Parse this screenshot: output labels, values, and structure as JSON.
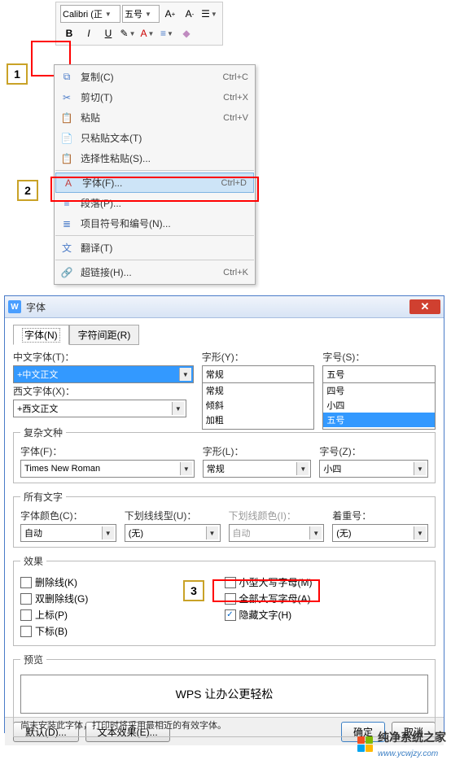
{
  "toolbar": {
    "font_family": "Calibri (正",
    "font_size": "五号",
    "bold": "B",
    "italic": "I",
    "underline": "U"
  },
  "context_menu": {
    "items": [
      {
        "icon": "copy",
        "label": "复制(C)",
        "shortcut": "Ctrl+C"
      },
      {
        "icon": "cut",
        "label": "剪切(T)",
        "shortcut": "Ctrl+X"
      },
      {
        "icon": "paste",
        "label": "粘贴",
        "shortcut": "Ctrl+V"
      },
      {
        "icon": "paste-text",
        "label": "只粘贴文本(T)",
        "shortcut": ""
      },
      {
        "icon": "paste-special",
        "label": "选择性粘贴(S)...",
        "shortcut": ""
      },
      {
        "icon": "font",
        "label": "字体(F)...",
        "shortcut": "Ctrl+D"
      },
      {
        "icon": "paragraph",
        "label": "段落(P)...",
        "shortcut": ""
      },
      {
        "icon": "bullets",
        "label": "项目符号和编号(N)...",
        "shortcut": ""
      },
      {
        "icon": "translate",
        "label": "翻译(T)",
        "shortcut": ""
      },
      {
        "icon": "link",
        "label": "超链接(H)...",
        "shortcut": "Ctrl+K"
      }
    ]
  },
  "dialog": {
    "title": "字体",
    "tabs": [
      "字体(N)",
      "字符间距(R)"
    ],
    "cn_font_label": "中文字体(T)：",
    "cn_font_value": "+中文正文",
    "style_label": "字形(Y)：",
    "style_value": "常规",
    "style_options": [
      "常规",
      "倾斜",
      "加粗"
    ],
    "size_label": "字号(S)：",
    "size_value": "五号",
    "size_options": [
      "四号",
      "小四",
      "五号"
    ],
    "en_font_label": "西文字体(X)：",
    "en_font_value": "+西文正文",
    "complex_legend": "复杂文种",
    "cx_font_label": "字体(F)：",
    "cx_font_value": "Times New Roman",
    "cx_style_label": "字形(L)：",
    "cx_style_value": "常规",
    "cx_size_label": "字号(Z)：",
    "cx_size_value": "小四",
    "all_text_legend": "所有文字",
    "color_label": "字体颜色(C)：",
    "color_value": "自动",
    "uline_label": "下划线线型(U)：",
    "uline_value": "(无)",
    "ucolor_label": "下划线颜色(I)：",
    "ucolor_value": "自动",
    "emph_label": "着重号：",
    "emph_value": "(无)",
    "effects_legend": "效果",
    "effects_left": [
      "删除线(K)",
      "双删除线(G)",
      "上标(P)",
      "下标(B)"
    ],
    "effects_right": [
      "小型大写字母(M)",
      "全部大写字母(A)",
      "隐藏文字(H)"
    ],
    "preview_legend": "预览",
    "preview_text": "WPS 让办公更轻松",
    "note": "尚未安装此字体，打印时将采用最相近的有效字体。",
    "btn_default": "默认(D)...",
    "btn_text_effect": "文本效果(E)...",
    "btn_ok": "确定",
    "btn_cancel": "取消"
  },
  "watermark": {
    "brand": "纯净系统之家",
    "url": "www.ycwjzy.com"
  },
  "annotations": {
    "n1": "1",
    "n2": "2",
    "n3": "3"
  }
}
